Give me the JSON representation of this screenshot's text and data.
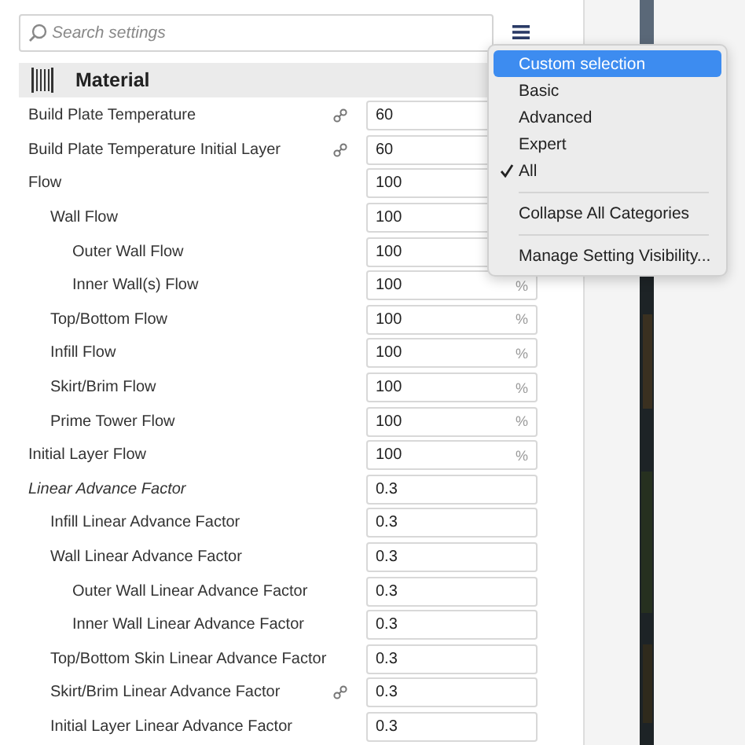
{
  "search": {
    "placeholder": "Search settings"
  },
  "category": {
    "title": "Material"
  },
  "settings": [
    {
      "label": "Build Plate Temperature",
      "linked": true,
      "italic": false,
      "value": "60"
    },
    {
      "label": "Build Plate Temperature Initial Layer",
      "linked": true,
      "italic": false,
      "value": "60"
    },
    {
      "label": "Flow",
      "linked": false,
      "italic": false,
      "value": "100",
      "children": [
        {
          "label": "Wall Flow",
          "linked": false,
          "italic": false,
          "value": "100",
          "children": [
            {
              "label": "Outer Wall Flow",
              "linked": false,
              "italic": false,
              "value": "100"
            },
            {
              "label": "Inner Wall(s) Flow",
              "linked": false,
              "italic": false,
              "value": "100",
              "unit": "%"
            }
          ]
        },
        {
          "label": "Top/Bottom Flow",
          "linked": false,
          "italic": false,
          "value": "100",
          "unit": "%"
        },
        {
          "label": "Infill Flow",
          "linked": false,
          "italic": false,
          "value": "100",
          "unit": "%"
        },
        {
          "label": "Skirt/Brim Flow",
          "linked": false,
          "italic": false,
          "value": "100",
          "unit": "%"
        },
        {
          "label": "Prime Tower Flow",
          "linked": false,
          "italic": false,
          "value": "100",
          "unit": "%"
        }
      ]
    },
    {
      "label": "Initial Layer Flow",
      "linked": false,
      "italic": false,
      "value": "100",
      "unit": "%"
    },
    {
      "label": "Linear Advance Factor",
      "linked": false,
      "italic": true,
      "value": "0.3",
      "children": [
        {
          "label": "Infill Linear Advance Factor",
          "linked": false,
          "italic": false,
          "value": "0.3"
        },
        {
          "label": "Wall Linear Advance Factor",
          "linked": false,
          "italic": false,
          "value": "0.3",
          "children": [
            {
              "label": "Outer Wall Linear Advance Factor",
              "linked": false,
              "italic": false,
              "value": "0.3"
            },
            {
              "label": "Inner Wall Linear Advance Factor",
              "linked": false,
              "italic": false,
              "value": "0.3"
            }
          ]
        },
        {
          "label": "Top/Bottom Skin Linear Advance Factor",
          "linked": false,
          "italic": false,
          "value": "0.3"
        },
        {
          "label": "Skirt/Brim Linear Advance Factor",
          "linked": true,
          "italic": false,
          "value": "0.3"
        },
        {
          "label": "Initial Layer Linear Advance Factor",
          "linked": false,
          "italic": false,
          "value": "0.3"
        }
      ]
    }
  ],
  "menu": {
    "groups": [
      [
        {
          "label": "Custom selection",
          "selected": true,
          "checked": false
        },
        {
          "label": "Basic",
          "selected": false,
          "checked": false
        },
        {
          "label": "Advanced",
          "selected": false,
          "checked": false
        },
        {
          "label": "Expert",
          "selected": false,
          "checked": false
        },
        {
          "label": "All",
          "selected": false,
          "checked": true
        }
      ],
      [
        {
          "label": "Collapse All Categories",
          "selected": false,
          "checked": false
        }
      ],
      [
        {
          "label": "Manage Setting Visibility...",
          "selected": false,
          "checked": false
        }
      ]
    ]
  }
}
